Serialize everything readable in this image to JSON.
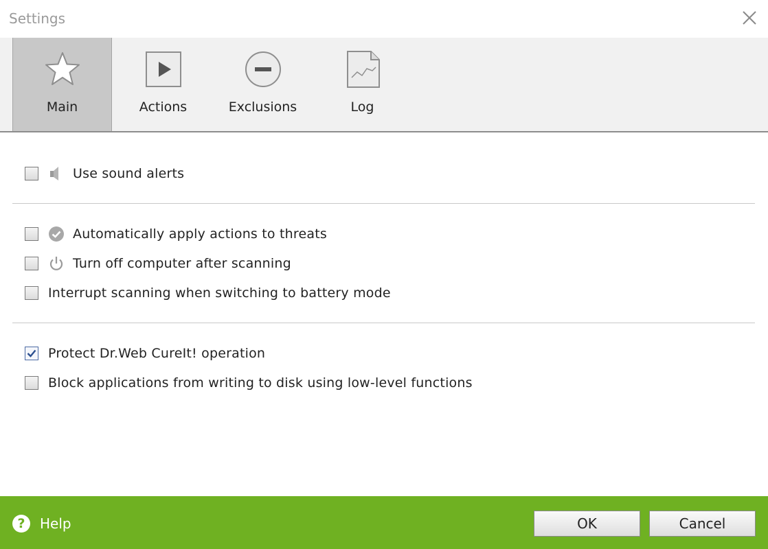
{
  "window": {
    "title": "Settings"
  },
  "tabs": [
    {
      "label": "Main",
      "icon": "star-icon",
      "active": true
    },
    {
      "label": "Actions",
      "icon": "play-icon",
      "active": false
    },
    {
      "label": "Exclusions",
      "icon": "minus-circle-icon",
      "active": false
    },
    {
      "label": "Log",
      "icon": "log-document-icon",
      "active": false
    }
  ],
  "options": [
    {
      "label": "Use sound alerts",
      "checked": false,
      "icon": "speaker-icon"
    },
    {
      "label": "Automatically apply actions to threats",
      "checked": false,
      "icon": "check-circle-icon"
    },
    {
      "label": "Turn off computer after scanning",
      "checked": false,
      "icon": "power-icon"
    },
    {
      "label": "Interrupt scanning when switching to battery mode",
      "checked": false
    },
    {
      "label": "Protect Dr.Web CureIt! operation",
      "checked": true
    },
    {
      "label": "Block applications from writing to disk using low-level functions",
      "checked": false
    }
  ],
  "footer": {
    "help_label": "Help",
    "ok_label": "OK",
    "cancel_label": "Cancel",
    "accent_color": "#6fb122"
  }
}
